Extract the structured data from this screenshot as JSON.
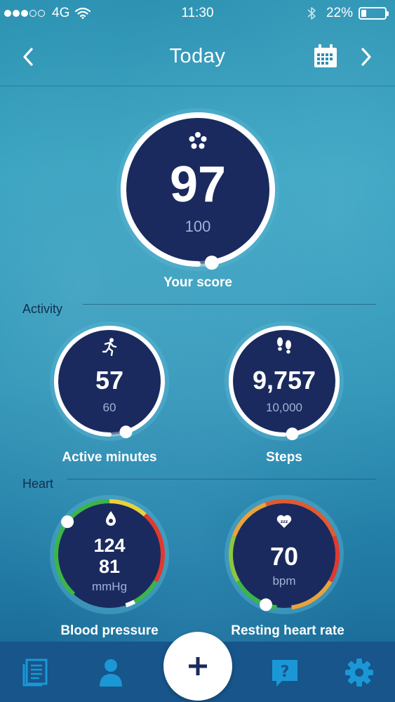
{
  "status_bar": {
    "signal_dots_full": 3,
    "signal_dots_empty": 2,
    "carrier": "4G",
    "time": "11:30",
    "battery_text": "22%",
    "battery_level": 0.22
  },
  "nav": {
    "title": "Today",
    "back_icon": "chevron-left-icon",
    "calendar_icon": "calendar-icon",
    "forward_icon": "chevron-right-icon"
  },
  "score": {
    "value": "97",
    "target": "100",
    "label": "Your score",
    "progress": 0.97,
    "icon": "flower-icon"
  },
  "activity": {
    "section_label": "Activity",
    "active_minutes": {
      "value": "57",
      "target": "60",
      "label": "Active minutes",
      "progress": 0.95,
      "icon": "running-person-icon"
    },
    "steps": {
      "value": "9,757",
      "target": "10,000",
      "label": "Steps",
      "progress": 0.9757,
      "icon": "footprints-icon"
    }
  },
  "heart": {
    "section_label": "Heart",
    "blood_pressure": {
      "systolic": "124",
      "diastolic": "81",
      "unit": "mmHg",
      "label": "Blood pressure",
      "icon": "blood-drop-icon"
    },
    "resting_heart_rate": {
      "value": "70",
      "unit": "bpm",
      "label": "Resting heart rate",
      "icon": "sleeping-heart-icon"
    }
  },
  "tab_bar": {
    "items": [
      {
        "icon": "journal-icon"
      },
      {
        "icon": "profile-icon"
      },
      {
        "icon": "add-icon"
      },
      {
        "icon": "help-icon"
      },
      {
        "icon": "settings-gear-icon"
      }
    ]
  },
  "colors": {
    "ring_fill": "#1a2a5e",
    "ring_track": "#ffffff",
    "target_text": "#9fb3d6",
    "gauge_green": "#3bb54a",
    "gauge_yellow": "#e8d23a",
    "gauge_red": "#e03a2f",
    "tab_bar": "#17558a"
  }
}
